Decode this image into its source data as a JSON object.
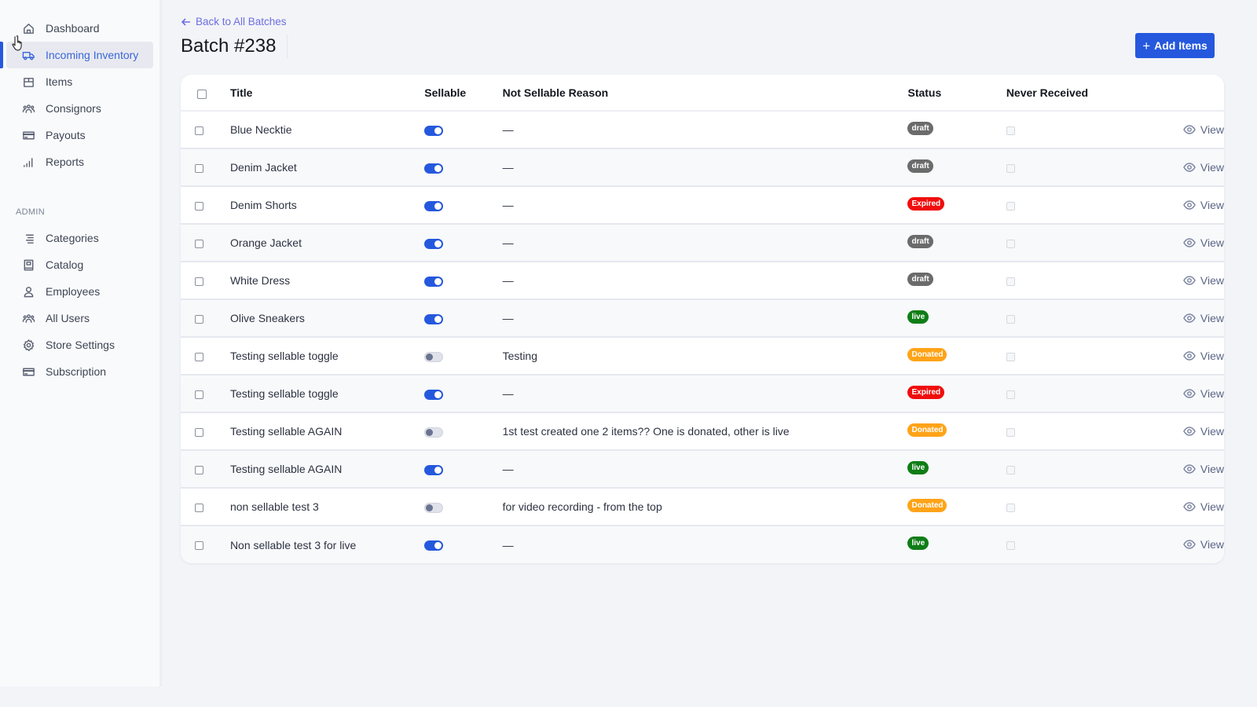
{
  "sidebar": {
    "items": [
      {
        "label": "Dashboard",
        "icon": "home-icon",
        "active": false
      },
      {
        "label": "Incoming Inventory",
        "icon": "truck-icon",
        "active": true
      },
      {
        "label": "Items",
        "icon": "box-icon",
        "active": false
      },
      {
        "label": "Consignors",
        "icon": "users-icon",
        "active": false
      },
      {
        "label": "Payouts",
        "icon": "credit-card-icon",
        "active": false
      },
      {
        "label": "Reports",
        "icon": "signal-bars-icon",
        "active": false
      }
    ],
    "admin_label": "ADMIN",
    "admin_items": [
      {
        "label": "Categories",
        "icon": "list-icon"
      },
      {
        "label": "Catalog",
        "icon": "book-icon"
      },
      {
        "label": "Employees",
        "icon": "user-icon"
      },
      {
        "label": "All Users",
        "icon": "users-icon"
      },
      {
        "label": "Store Settings",
        "icon": "gear-icon"
      },
      {
        "label": "Subscription",
        "icon": "credit-card-icon"
      }
    ]
  },
  "header": {
    "back_label": "Back to All Batches",
    "title": "Batch #238",
    "add_button_label": "Add Items"
  },
  "table": {
    "columns": [
      "Title",
      "Sellable",
      "Not Sellable Reason",
      "Status",
      "Never Received",
      ""
    ],
    "action_label": "View",
    "status_colors": {
      "draft": "#6b6b6b",
      "Expired": "#f00d0d",
      "live": "#0f7d16",
      "Donated": "#ffa318"
    },
    "rows": [
      {
        "title": "Blue Necktie",
        "sellable": true,
        "reason": "—",
        "status": "draft",
        "never_received": false
      },
      {
        "title": "Denim Jacket",
        "sellable": true,
        "reason": "—",
        "status": "draft",
        "never_received": false
      },
      {
        "title": "Denim Shorts",
        "sellable": true,
        "reason": "—",
        "status": "Expired",
        "never_received": false
      },
      {
        "title": "Orange Jacket",
        "sellable": true,
        "reason": "—",
        "status": "draft",
        "never_received": false
      },
      {
        "title": "White Dress",
        "sellable": true,
        "reason": "—",
        "status": "draft",
        "never_received": false
      },
      {
        "title": "Olive Sneakers",
        "sellable": true,
        "reason": "—",
        "status": "live",
        "never_received": false
      },
      {
        "title": "Testing sellable toggle",
        "sellable": false,
        "reason": "Testing",
        "status": "Donated",
        "never_received": false
      },
      {
        "title": "Testing sellable toggle",
        "sellable": true,
        "reason": "—",
        "status": "Expired",
        "never_received": false
      },
      {
        "title": "Testing sellable AGAIN",
        "sellable": false,
        "reason": "1st test created one 2 items?? One is donated, other is live",
        "status": "Donated",
        "never_received": false
      },
      {
        "title": "Testing sellable AGAIN",
        "sellable": true,
        "reason": "—",
        "status": "live",
        "never_received": false
      },
      {
        "title": "non sellable test 3",
        "sellable": false,
        "reason": "for video recording - from the top",
        "status": "Donated",
        "never_received": false
      },
      {
        "title": "Non sellable test 3 for live",
        "sellable": true,
        "reason": "—",
        "status": "live",
        "never_received": false
      }
    ]
  }
}
